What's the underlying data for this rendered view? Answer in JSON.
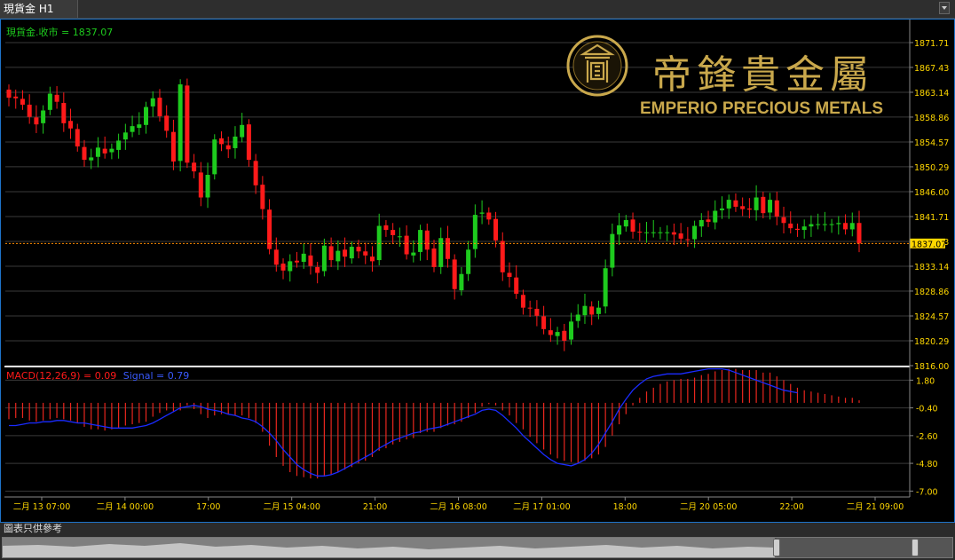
{
  "window": {
    "tab_label": "現貨金 H1"
  },
  "price_panel": {
    "caption": "現貨金.收市 = 1837.07",
    "last_price_tag": "1837.07",
    "y_ticks": [
      "1871.71",
      "1867.43",
      "1863.14",
      "1858.86",
      "1854.57",
      "1850.29",
      "1846.00",
      "1841.71",
      "1837.43",
      "1833.14",
      "1828.86",
      "1824.57",
      "1820.29",
      "1816.00"
    ]
  },
  "branding": {
    "chinese_name": "帝鋒貴金屬",
    "english_name": "EMPERIO PRECIOUS METALS"
  },
  "macd_panel": {
    "caption_macd": "MACD(12,26,9) = 0.09",
    "caption_signal": "Signal = 0.79",
    "y_ticks": [
      "1.80",
      "-0.40",
      "-2.60",
      "-4.80",
      "-7.00"
    ]
  },
  "x_ticks": [
    "二月 13 07:00",
    "二月 14 00:00",
    "17:00",
    "二月 15 04:00",
    "21:00",
    "二月 16 08:00",
    "二月 17 01:00",
    "18:00",
    "二月 20 05:00",
    "22:00",
    "二月 21 09:00"
  ],
  "footer": {
    "disclaimer": "圖表只供參考"
  },
  "colors": {
    "bull": "#1ecb1e",
    "bear": "#ff1a1a",
    "signal": "#1a2bff",
    "axis_text": "#ffd700",
    "frame": "#1e73c9",
    "last_price_line": "#ff8c00"
  },
  "chart_data": [
    {
      "type": "candlestick",
      "series_label": "現貨金.收市",
      "ylim": [
        1816.0,
        1874.0
      ],
      "last": 1837.07,
      "close": [
        1862.2,
        1862.1,
        1861.0,
        1858.9,
        1857.6,
        1860.0,
        1862.9,
        1861.5,
        1857.8,
        1856.9,
        1853.8,
        1851.5,
        1851.9,
        1853.6,
        1852.6,
        1853.4,
        1854.8,
        1856.2,
        1857.3,
        1857.6,
        1860.6,
        1862.1,
        1859.0,
        1856.5,
        1851.2,
        1864.5,
        1851.0,
        1849.5,
        1845.0,
        1848.9,
        1855.0,
        1854.2,
        1853.3,
        1855.5,
        1857.5,
        1851.5,
        1847.1,
        1843.0,
        1836.1,
        1833.4,
        1832.4,
        1834.0,
        1833.8,
        1835.3,
        1833.2,
        1832.0,
        1836.7,
        1834.2,
        1835.8,
        1834.8,
        1836.5,
        1835.7,
        1835.0,
        1834.0,
        1840.1,
        1839.4,
        1838.5,
        1838.3,
        1835.2,
        1835.5,
        1839.4,
        1836.0,
        1833.0,
        1838.0,
        1834.4,
        1829.2,
        1831.8,
        1836.0,
        1842.0,
        1842.4,
        1841.2,
        1837.6,
        1832.1,
        1831.3,
        1828.4,
        1826.0,
        1825.9,
        1824.6,
        1822.3,
        1821.3,
        1821.8,
        1820.3,
        1823.6,
        1824.8,
        1826.3,
        1824.8,
        1826.0,
        1832.8,
        1838.7,
        1840.2,
        1841.1,
        1839.1,
        1839.0,
        1839.0,
        1839.0,
        1839.0,
        1839.0,
        1838.6,
        1837.9,
        1837.7,
        1840.1,
        1841.1,
        1840.8,
        1842.7,
        1843.1,
        1844.6,
        1843.4,
        1843.0,
        1842.9,
        1845.0,
        1842.3,
        1844.6,
        1841.7,
        1840.6,
        1839.7,
        1839.4,
        1840.0,
        1840.4,
        1840.4,
        1840.4,
        1840.4,
        1840.6,
        1839.5,
        1840.6,
        1837.07
      ],
      "open": [
        1863.6,
        1862.4,
        1862.0,
        1861.0,
        1858.8,
        1857.8,
        1860.1,
        1862.7,
        1861.3,
        1858.2,
        1856.8,
        1853.7,
        1851.4,
        1852.0,
        1853.4,
        1852.8,
        1853.2,
        1855.0,
        1856.3,
        1857.0,
        1857.5,
        1860.7,
        1862.2,
        1859.1,
        1856.3,
        1851.3,
        1864.3,
        1851.0,
        1849.3,
        1845.0,
        1849.0,
        1855.2,
        1854.0,
        1853.5,
        1855.4,
        1857.6,
        1851.3,
        1847.2,
        1842.9,
        1836.0,
        1833.6,
        1832.3,
        1834.1,
        1833.9,
        1835.0,
        1833.0,
        1832.3,
        1836.6,
        1834.0,
        1836.0,
        1834.5,
        1836.5,
        1835.7,
        1834.8,
        1834.2,
        1840.2,
        1839.4,
        1838.3,
        1838.4,
        1835.0,
        1835.6,
        1839.3,
        1836.2,
        1833.0,
        1838.0,
        1834.3,
        1829.0,
        1831.8,
        1836.1,
        1842.2,
        1842.4,
        1841.3,
        1837.5,
        1832.0,
        1831.2,
        1828.2,
        1826.0,
        1825.8,
        1824.5,
        1822.1,
        1821.1,
        1822.0,
        1820.5,
        1823.7,
        1824.7,
        1826.2,
        1824.9,
        1826.2,
        1832.9,
        1838.6,
        1840.0,
        1841.2,
        1839.1,
        1839.0,
        1839.0,
        1839.0,
        1839.0,
        1839.0,
        1838.8,
        1837.8,
        1837.8,
        1840.0,
        1841.2,
        1840.7,
        1842.8,
        1843.1,
        1844.5,
        1843.5,
        1843.1,
        1842.8,
        1845.1,
        1842.4,
        1844.5,
        1841.6,
        1840.5,
        1839.6,
        1839.4,
        1840.0,
        1840.4,
        1840.4,
        1840.4,
        1840.4,
        1840.6,
        1839.5,
        1840.6
      ]
    },
    {
      "type": "line",
      "title": "MACD(12,26,9)",
      "ylim": [
        -7.4,
        2.6
      ],
      "histogram": [
        -1.3,
        -1.2,
        -1.2,
        -1.4,
        -1.5,
        -1.4,
        -1.3,
        -1.2,
        -1.3,
        -1.4,
        -1.6,
        -1.9,
        -2.1,
        -2.1,
        -2.2,
        -2.1,
        -2.0,
        -1.8,
        -1.7,
        -1.6,
        -1.5,
        -1.1,
        -0.8,
        -0.6,
        -0.7,
        -0.6,
        -0.2,
        -0.5,
        -0.9,
        -1.2,
        -1.0,
        -0.9,
        -0.9,
        -1.0,
        -1.0,
        -1.2,
        -1.6,
        -2.3,
        -3.4,
        -4.3,
        -5.0,
        -5.5,
        -5.8,
        -5.9,
        -6.0,
        -6.0,
        -5.8,
        -5.7,
        -5.5,
        -5.3,
        -5.1,
        -4.8,
        -4.6,
        -4.3,
        -3.8,
        -3.6,
        -3.3,
        -3.1,
        -2.9,
        -2.8,
        -2.4,
        -2.3,
        -2.3,
        -2.0,
        -1.8,
        -1.7,
        -1.5,
        -1.2,
        -0.8,
        -0.3,
        -0.1,
        -0.2,
        -0.6,
        -1.0,
        -1.6,
        -2.1,
        -2.7,
        -3.2,
        -3.7,
        -4.1,
        -4.4,
        -4.6,
        -4.7,
        -4.8,
        -4.6,
        -4.4,
        -4.1,
        -3.5,
        -2.6,
        -1.7,
        -0.9,
        -0.2,
        0.4,
        0.9,
        1.2,
        1.5,
        1.7,
        1.8,
        1.9,
        1.9,
        2.0,
        2.2,
        2.3,
        2.5,
        2.6,
        2.7,
        2.7,
        2.6,
        2.6,
        2.6,
        2.4,
        2.4,
        2.1,
        1.8,
        1.5,
        1.2,
        1.0,
        0.9,
        0.8,
        0.7,
        0.6,
        0.5,
        0.4,
        0.4,
        0.2
      ],
      "signal": [
        -1.8,
        -1.8,
        -1.7,
        -1.6,
        -1.6,
        -1.5,
        -1.5,
        -1.4,
        -1.4,
        -1.5,
        -1.6,
        -1.6,
        -1.7,
        -1.8,
        -1.9,
        -2.0,
        -2.0,
        -2.0,
        -2.0,
        -1.9,
        -1.8,
        -1.6,
        -1.3,
        -1.0,
        -0.7,
        -0.4,
        -0.3,
        -0.2,
        -0.3,
        -0.5,
        -0.6,
        -0.7,
        -0.9,
        -1.0,
        -1.2,
        -1.3,
        -1.5,
        -1.9,
        -2.4,
        -3.0,
        -3.7,
        -4.3,
        -4.9,
        -5.3,
        -5.6,
        -5.8,
        -5.8,
        -5.7,
        -5.5,
        -5.2,
        -4.9,
        -4.6,
        -4.3,
        -4.0,
        -3.6,
        -3.3,
        -3.0,
        -2.8,
        -2.6,
        -2.4,
        -2.3,
        -2.1,
        -2.0,
        -1.9,
        -1.7,
        -1.5,
        -1.3,
        -1.1,
        -0.9,
        -0.6,
        -0.5,
        -0.6,
        -1.0,
        -1.5,
        -2.0,
        -2.6,
        -3.1,
        -3.6,
        -4.1,
        -4.5,
        -4.8,
        -4.9,
        -5.0,
        -4.8,
        -4.5,
        -4.0,
        -3.3,
        -2.4,
        -1.5,
        -0.5,
        0.3,
        1.0,
        1.5,
        1.9,
        2.1,
        2.2,
        2.3,
        2.3,
        2.3,
        2.4,
        2.5,
        2.6,
        2.7,
        2.7,
        2.7,
        2.6,
        2.4,
        2.2,
        2.0,
        1.8,
        1.6,
        1.4,
        1.2,
        1.0,
        0.9,
        0.8
      ]
    }
  ]
}
